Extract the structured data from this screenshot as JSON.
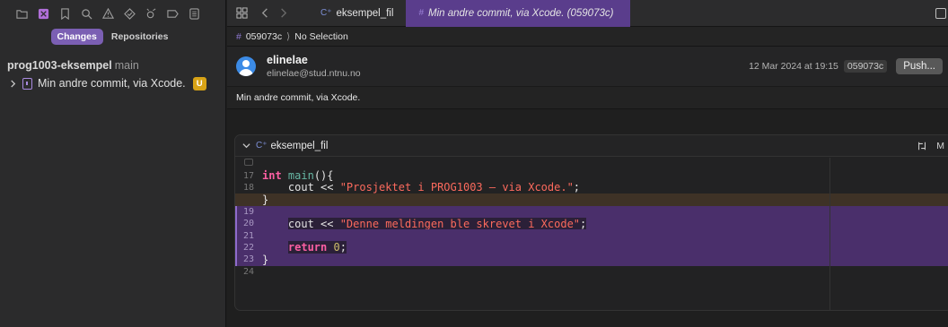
{
  "sidebar": {
    "nav_icons": [
      "folder-icon",
      "source-control-icon",
      "bookmark-icon",
      "find-icon",
      "issues-icon",
      "tests-icon",
      "debug-icon",
      "breakpoints-icon",
      "reports-icon"
    ],
    "segments": [
      {
        "label": "Changes",
        "selected": true
      },
      {
        "label": "Repositories",
        "selected": false
      }
    ],
    "repo": {
      "name": "prog1003-eksempel",
      "branch": "main"
    },
    "commit": {
      "label": "Min andre commit, via Xcode.",
      "badge": "U"
    }
  },
  "tabbar": {
    "tabs": [
      {
        "glyph": "C⁺",
        "label": "eksempel_fil",
        "active": false
      },
      {
        "glyph": "#",
        "label": "Min andre commit, via Xcode. (059073c)",
        "active": true
      }
    ]
  },
  "breadcrumb": {
    "hash_glyph": "#",
    "commit": "059073c",
    "separator": "⟩",
    "selection": "No Selection"
  },
  "commit_detail": {
    "author_name": "elinelae",
    "author_email": "elinelae@stud.ntnu.no",
    "date": "12 Mar 2024 at 19:15",
    "hash": "059073c",
    "push_label": "Push...",
    "message": "Min andre commit, via Xcode."
  },
  "diff": {
    "file_glyph": "C⁺",
    "file_name": "eksempel_fil",
    "status": "M",
    "lines": [
      {
        "num": "",
        "kind": "box"
      },
      {
        "num": "17",
        "kind": "ctx",
        "text": "int main(){"
      },
      {
        "num": "18",
        "kind": "ctx",
        "text": "    cout << \"Prosjektet i PROG1003 – via Xcode.\";"
      },
      {
        "num": "",
        "kind": "mark",
        "text": "}"
      },
      {
        "num": "19",
        "kind": "add",
        "text": ""
      },
      {
        "num": "20",
        "kind": "add",
        "text": "    cout << \"Denne meldingen ble skrevet i Xcode\";"
      },
      {
        "num": "21",
        "kind": "add",
        "text": ""
      },
      {
        "num": "22",
        "kind": "add",
        "text": "    return 0;"
      },
      {
        "num": "23",
        "kind": "add",
        "text": "}"
      },
      {
        "num": "24",
        "kind": "ctx",
        "text": ""
      }
    ]
  },
  "colors": {
    "accent": "#7b5fb3",
    "added_bg": "#4a2f6b",
    "badge": "#d8a316",
    "avatar": "#3c8be6"
  }
}
